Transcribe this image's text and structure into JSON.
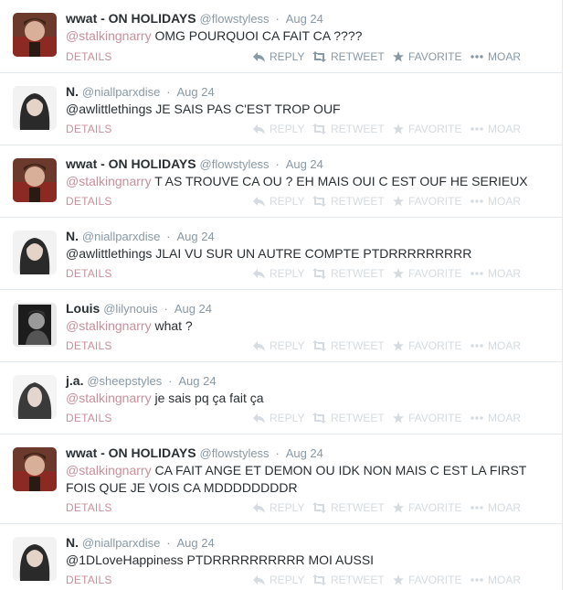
{
  "actions": {
    "details": "DETAILS",
    "reply": "REPLY",
    "retweet": "RETWEET",
    "favorite": "FAVORITE",
    "more": "MOAR"
  },
  "colors": {
    "mention": "#c8909a",
    "meta": "#8899a6",
    "divider": "#e1e8ed"
  },
  "tweets": [
    {
      "fullname": "wwat - ON HOLIDAYS",
      "username": "@flowstyless",
      "time": "Aug 24",
      "mention": "@stalkingnarry",
      "text": " OMG POURQUOI CA FAIT CA ????"
    },
    {
      "fullname": "N.",
      "username": "@niallparxdise",
      "time": "Aug 24",
      "mention": "",
      "text": "@awlittlethings JE SAIS PAS C'EST TROP OUF"
    },
    {
      "fullname": "wwat - ON HOLIDAYS",
      "username": "@flowstyless",
      "time": "Aug 24",
      "mention": "@stalkingnarry",
      "text": " T AS TROUVE CA OU ? EH MAIS OUI C EST OUF HE SERIEUX"
    },
    {
      "fullname": "N.",
      "username": "@niallparxdise",
      "time": "Aug 24",
      "mention": "",
      "text": "@awlittlethings JLAI VU SUR UN AUTRE COMPTE PTDRRRRRRRRR"
    },
    {
      "fullname": "Louis",
      "username": "@lilynouis",
      "time": "Aug 24",
      "mention": "@stalkingnarry",
      "text": " what ?"
    },
    {
      "fullname": "j.a.",
      "username": "@sheepstyles",
      "time": "Aug 24",
      "mention": "@stalkingnarry",
      "text": " je sais pq ça fait ça"
    },
    {
      "fullname": "wwat - ON HOLIDAYS",
      "username": "@flowstyless",
      "time": "Aug 24",
      "mention": "@stalkingnarry",
      "text": " CA FAIT ANGE ET DEMON OU IDK NON MAIS C EST LA FIRST FOIS QUE JE VOIS CA MDDDDDDDDR"
    },
    {
      "fullname": "N.",
      "username": "@niallparxdise",
      "time": "Aug 24",
      "mention": "",
      "text": "@1DLoveHappiness PTDRRRRRRRRRR MOI AUSSI"
    }
  ]
}
